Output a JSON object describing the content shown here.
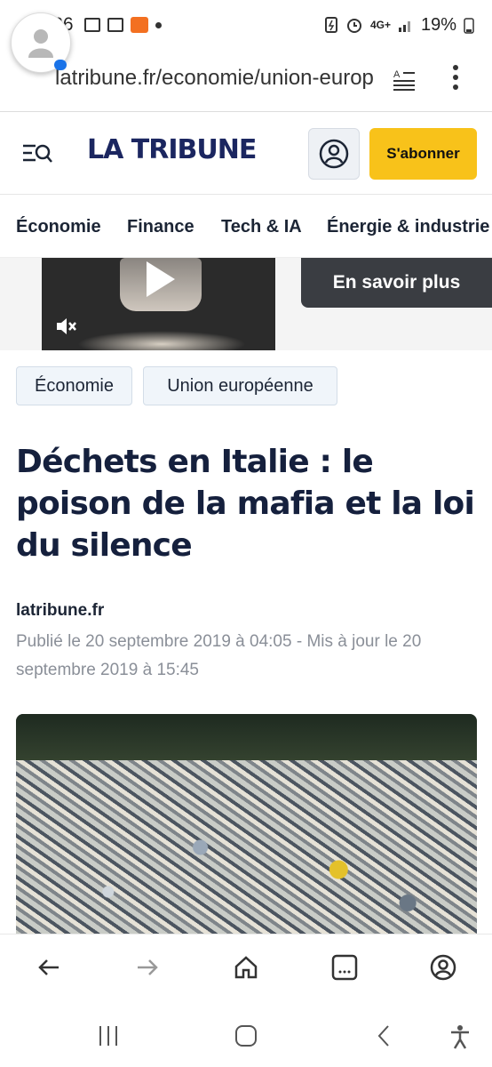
{
  "status_bar": {
    "time": "01:26",
    "network": "4G+",
    "battery": "19%"
  },
  "browser": {
    "url": "latribune.fr/economie/union-europ"
  },
  "site": {
    "logo": "LA TRIBUNE",
    "subscribe_label": "S'abonner"
  },
  "nav": {
    "items": [
      "Économie",
      "Finance",
      "Tech & IA",
      "Énergie & industrie"
    ]
  },
  "ad": {
    "cta_label": "En savoir plus"
  },
  "tags": [
    "Économie",
    "Union européenne"
  ],
  "article": {
    "title": "Déchets en Italie : le poison de la mafia et la loi du silence",
    "source": "latribune.fr",
    "meta": "Publié le 20 septembre 2019 à 04:05 - Mis à jour le 20 septembre 2019 à 15:45"
  },
  "icons": {
    "status": [
      "image-icon",
      "calendar-icon",
      "temu-icon",
      "notification-dot-icon",
      "battery-saver-icon",
      "alarm-icon",
      "signal-icon",
      "battery-icon"
    ],
    "toolbar": [
      "back-arrow-icon",
      "forward-arrow-icon",
      "home-icon",
      "tabs-icon",
      "account-icon"
    ],
    "system": [
      "recents-icon",
      "home-button-icon",
      "back-icon",
      "accessibility-icon"
    ]
  },
  "colors": {
    "brand": "#1b2660",
    "subscribe": "#f8c21a",
    "cta_bg": "#3a3d42"
  }
}
